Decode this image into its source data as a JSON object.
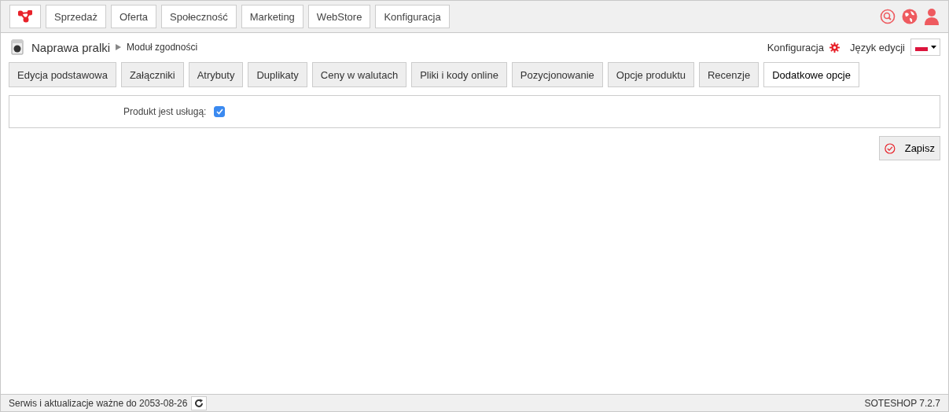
{
  "nav": [
    "Sprzedaż",
    "Oferta",
    "Społeczność",
    "Marketing",
    "WebStore",
    "Konfiguracja"
  ],
  "breadcrumb": {
    "product": "Naprawa pralki",
    "module": "Moduł zgodności"
  },
  "config_link": "Konfiguracja",
  "language_label": "Język edycji",
  "tabs": [
    {
      "label": "Edycja podstawowa",
      "selected": false
    },
    {
      "label": "Załączniki",
      "selected": false
    },
    {
      "label": "Atrybuty",
      "selected": false
    },
    {
      "label": "Duplikaty",
      "selected": false
    },
    {
      "label": "Ceny w walutach",
      "selected": false
    },
    {
      "label": "Pliki i kody online",
      "selected": false
    },
    {
      "label": "Pozycjonowanie",
      "selected": false
    },
    {
      "label": "Opcje produktu",
      "selected": false
    },
    {
      "label": "Recenzje",
      "selected": false
    },
    {
      "label": "Dodatkowe opcje",
      "selected": true
    }
  ],
  "form": {
    "label": "Produkt jest usługą:",
    "checked": true
  },
  "save_button": "Zapisz",
  "status_bar": {
    "license": "Serwis i aktualizacje ważne do 2053-08-26",
    "version": "SOTESHOP 7.2.7"
  }
}
